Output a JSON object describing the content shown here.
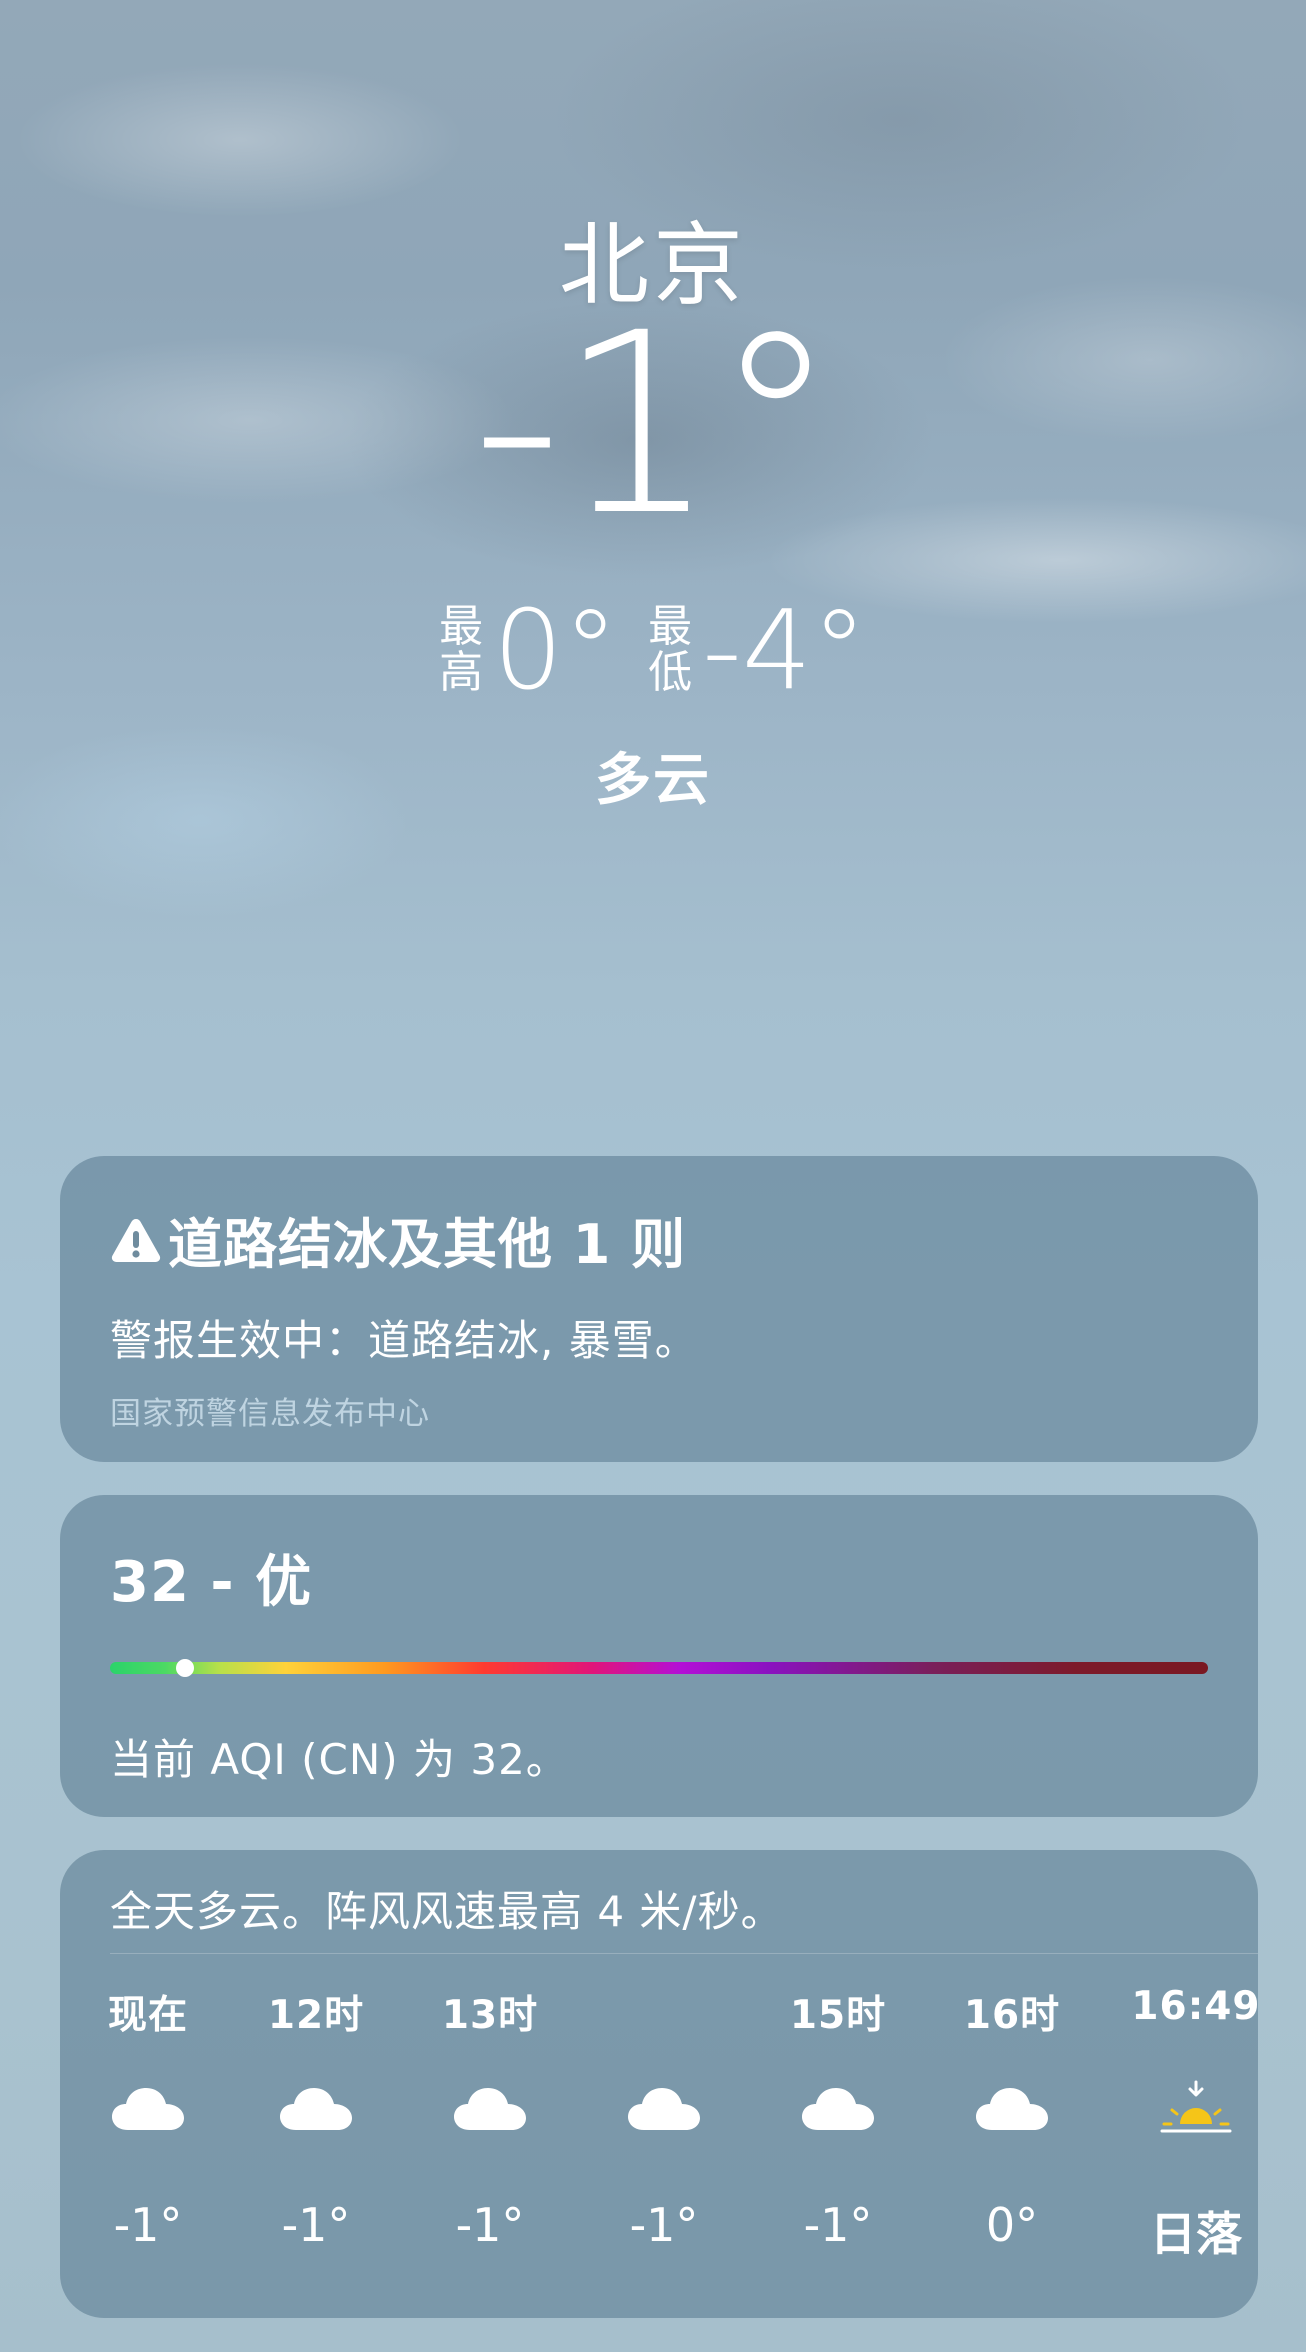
{
  "location": {
    "city": "北京",
    "current_temp": "-1°",
    "high_label_top": "最",
    "high_label_bottom": "高",
    "high_value": "0°",
    "low_label_top": "最",
    "low_label_bottom": "低",
    "low_value": "-4°",
    "condition": "多云"
  },
  "alert": {
    "icon": "warning-triangle-icon",
    "title": "道路结冰及其他 1 则",
    "body": "警报生效中：道路结冰, 暴雪。",
    "source": "国家预警信息发布中心"
  },
  "aqi": {
    "title": "32 - 优",
    "value": 32,
    "level_fraction": 0.068,
    "description": "当前 AQI (CN) 为 32。"
  },
  "hourly": {
    "summary": "全天多云。阵风风速最高 4 米/秒。",
    "items": [
      {
        "time": "现在",
        "icon": "cloud-icon",
        "temp": "-1°"
      },
      {
        "time": "12时",
        "icon": "cloud-icon",
        "temp": "-1°"
      },
      {
        "time": "13时",
        "icon": "cloud-icon",
        "temp": "-1°"
      },
      {
        "time": "",
        "icon": "cloud-icon",
        "temp": "-1°"
      },
      {
        "time": "15时",
        "icon": "cloud-icon",
        "temp": "-1°"
      },
      {
        "time": "16时",
        "icon": "cloud-icon",
        "temp": "0°"
      },
      {
        "time": "16:49",
        "icon": "sunset-icon",
        "temp": "日落"
      }
    ]
  },
  "colors": {
    "sun_yellow": "#f5c518",
    "aqi_good": "#2bd36a"
  }
}
